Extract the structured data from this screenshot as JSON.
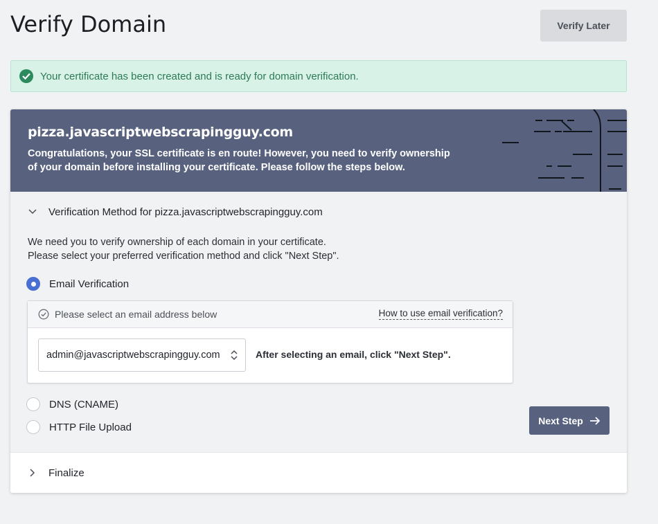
{
  "page": {
    "title": "Verify Domain",
    "verify_later_label": "Verify Later"
  },
  "alert": {
    "message": "Your certificate has been created and is ready for domain verification."
  },
  "header": {
    "domain": "pizza.javascriptwebscrapingguy.com",
    "description_line1": "Congratulations, your SSL certificate is en route! However, you need to verify ownership",
    "description_line2": "of your domain before installing your certificate. Please follow the steps below."
  },
  "verification": {
    "section_label": "Verification Method for pizza.javascriptwebscrapingguy.com",
    "intro_line1": "We need you to verify ownership of each domain in your certificate.",
    "intro_line2": "Please select your preferred verification method and click \"Next Step\".",
    "methods": [
      {
        "label": "Email Verification",
        "selected": true
      },
      {
        "label": "DNS (CNAME)",
        "selected": false
      },
      {
        "label": "HTTP File Upload",
        "selected": false
      }
    ],
    "email_box": {
      "heading": "Please select an email address below",
      "help_link": "How to use email verification?",
      "selected_email": "admin@javascriptwebscrapingguy.com",
      "after_text": "After selecting an email, click \"Next Step\"."
    },
    "next_step_label": "Next Step"
  },
  "finalize": {
    "label": "Finalize"
  },
  "colors": {
    "header_bg": "#58627f",
    "alert_bg": "#d8f2e8",
    "alert_text": "#2d7a55",
    "radio_selected": "#4a6fd2",
    "page_bg": "#f1f2f4"
  }
}
